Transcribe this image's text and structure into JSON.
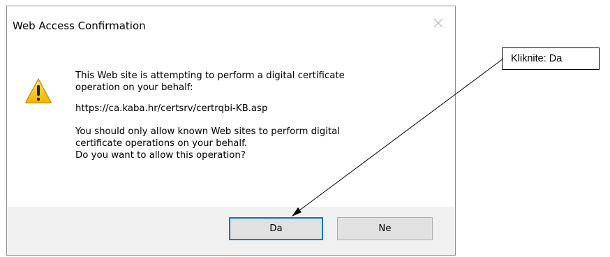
{
  "dialog": {
    "title": "Web Access Confirmation",
    "icon": "warning-icon",
    "message": {
      "line1": "This Web site is attempting to perform a digital certificate",
      "line2": "operation on your behalf:",
      "url": "https://ca.kaba.hr/certsrv/certrqbi-KB.asp",
      "line3": "You should only allow known Web sites to perform digital",
      "line4": "certificate operations on your behalf.",
      "line5": "Do you want to allow this operation?"
    },
    "buttons": {
      "yes_label": "Da",
      "no_label": "Ne"
    },
    "colors": {
      "footer": "#f0f0f0",
      "default_button_border": "#0078d7",
      "warning_yellow": "#f5c400"
    }
  },
  "annotation": {
    "callout_text": "Kliknite: Da"
  }
}
